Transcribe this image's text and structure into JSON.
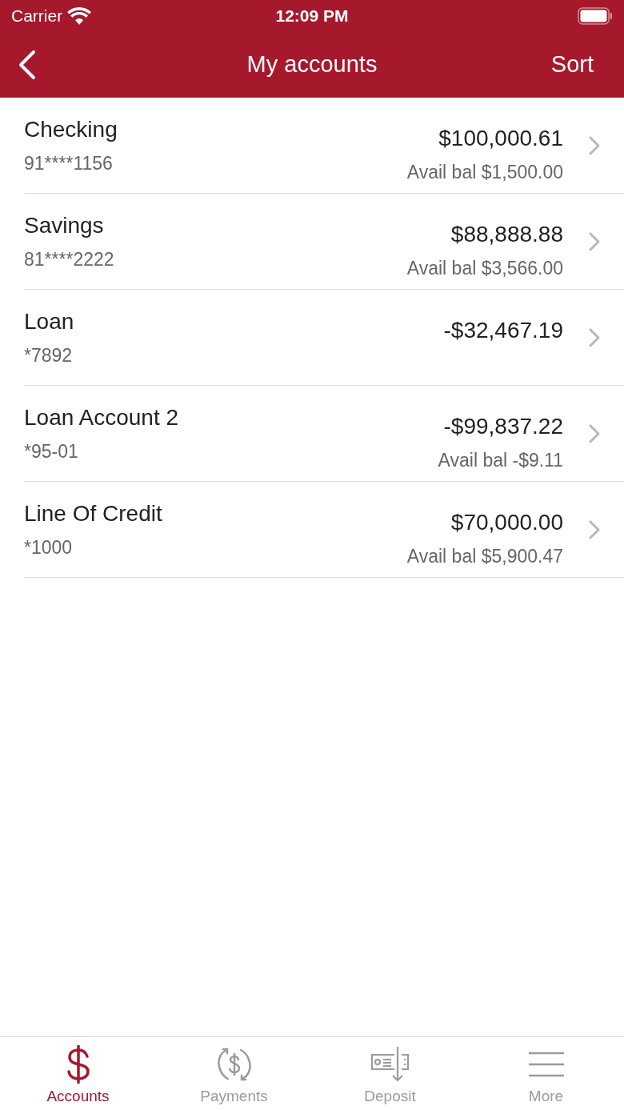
{
  "status_bar": {
    "carrier": "Carrier",
    "time": "12:09 PM"
  },
  "nav": {
    "title": "My accounts",
    "action": "Sort"
  },
  "accounts": [
    {
      "name": "Checking",
      "number": "91****1156",
      "balance": "$100,000.61",
      "available": "Avail bal $1,500.00"
    },
    {
      "name": "Savings",
      "number": "81****2222",
      "balance": "$88,888.88",
      "available": "Avail bal $3,566.00"
    },
    {
      "name": "Loan",
      "number": "*7892",
      "balance": "-$32,467.19"
    },
    {
      "name": "Loan Account 2",
      "number": "*95-01",
      "balance": "-$99,837.22",
      "available": "Avail bal -$9.11"
    },
    {
      "name": "Line Of Credit",
      "number": "*1000",
      "balance": "$70,000.00",
      "available": "Avail bal $5,900.47"
    }
  ],
  "tabs": [
    {
      "kind": "accounts",
      "label": "Accounts",
      "selected": true
    },
    {
      "kind": "payments",
      "label": "Payments",
      "selected": false
    },
    {
      "kind": "deposit",
      "label": "Deposit",
      "selected": false
    },
    {
      "kind": "more",
      "label": "More",
      "selected": false
    }
  ]
}
